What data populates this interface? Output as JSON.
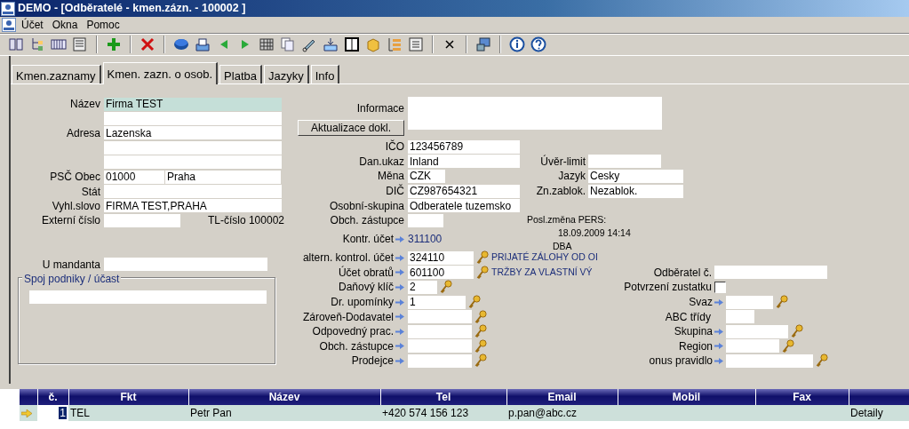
{
  "window": {
    "title": "DEMO - [Odběratelé - kmen.zázn. - 100002 ]"
  },
  "menu": {
    "items": [
      {
        "label": "Účet"
      },
      {
        "label": "Okna"
      },
      {
        "label": "Pomoc"
      }
    ]
  },
  "tabs": [
    {
      "label": "Kmen.zaznamy",
      "selected": false
    },
    {
      "label": "Kmen. zazn. o osob.",
      "selected": true
    },
    {
      "label": "Platba",
      "selected": false
    },
    {
      "label": "Jazyky",
      "selected": false
    },
    {
      "label": "Info",
      "selected": false
    }
  ],
  "left_fields": [
    {
      "kind": "field",
      "label": "Název",
      "value": "Firma TEST",
      "focused": true
    },
    {
      "kind": "field",
      "focused": false
    },
    {
      "kind": "field",
      "label": "Adresa",
      "value": "Lazenska",
      "focused": false
    },
    {
      "kind": "field",
      "focused": false
    },
    {
      "kind": "field",
      "focused": false
    },
    {
      "kind": "pair",
      "label": "PSČ Obec",
      "value": "01000",
      "value2": "Praha",
      "focused": false
    },
    {
      "kind": "field",
      "label": "Stát",
      "focused": false
    },
    {
      "kind": "field",
      "label": "Vyhl.slovo",
      "value": "FIRMA TEST,PRAHA",
      "focused": false
    },
    {
      "kind": "short",
      "label": "Externí číslo",
      "note": "TL-číslo 100002",
      "focused": false
    },
    {
      "kind": "field",
      "label": "U mandanta",
      "focused": false
    }
  ],
  "group": {
    "title": "Spoj podniky / účast"
  },
  "info": {
    "label": "Informace",
    "button": "Aktualizace dokl."
  },
  "middle_fields": [
    {
      "kind": "field",
      "label": "IČO",
      "value": "123456789"
    },
    {
      "kind": "field",
      "label": "Dan.ukaz",
      "value": "Inland"
    },
    {
      "kind": "field",
      "label": "Měna",
      "value": "CZK"
    },
    {
      "kind": "field",
      "label": "DIČ",
      "value": "CZ987654321"
    },
    {
      "kind": "field",
      "label": "Osobní-skupina",
      "value": "Odberatele tuzemsko"
    },
    {
      "kind": "field",
      "label": "Obch. zástupce"
    },
    {
      "kind": "link",
      "label": "Kontr. účet",
      "value": "311100"
    },
    {
      "kind": "lookup",
      "label": "altern. kontrol. účet",
      "value": "324110",
      "description": "PRIJATÉ ZÁLOHY OD OI"
    },
    {
      "kind": "lookup",
      "label": "Účet obratů",
      "value": "601100",
      "description": "TRŽBY ZA VLASTNÍ VÝ"
    },
    {
      "kind": "lookup",
      "label": "Daňový klíč",
      "value": "2"
    },
    {
      "kind": "lookup",
      "label": "Dr. upomínky",
      "value": "1"
    },
    {
      "kind": "lookup",
      "label": "Zároveň-Dodavatel"
    },
    {
      "kind": "lookup",
      "label": "Odpovedný prac."
    },
    {
      "kind": "lookup",
      "label": "Obch. zástupce"
    },
    {
      "kind": "lookup",
      "label": "Prodejce"
    }
  ],
  "right_fields": [
    {
      "kind": "field",
      "label": "Úvěr-limit"
    },
    {
      "kind": "field",
      "label": "Jazyk",
      "value": "Cesky"
    },
    {
      "kind": "field",
      "label": "Zn.zablok.",
      "value": "Nezablok."
    },
    {
      "kind": "note",
      "lines": [
        "Posl.změna PERS:",
        "18.09.2009 14:14",
        "DBA"
      ]
    },
    {
      "kind": "field",
      "label": "Odběratel č."
    },
    {
      "kind": "checkbox",
      "label": "Potvrzení zustatku",
      "checked": false
    },
    {
      "kind": "lookup",
      "label": "Svaz"
    },
    {
      "kind": "plain",
      "label": "ABC třídy"
    },
    {
      "kind": "lookup",
      "label": "Skupina"
    },
    {
      "kind": "lookup",
      "label": "Region"
    },
    {
      "kind": "lookup",
      "label": "onus pravidlo"
    }
  ],
  "table": {
    "columns": [
      "č.",
      "Fkt",
      "Název",
      "Tel",
      "Email",
      "Mobil",
      "Fax",
      null
    ],
    "rows": [
      {
        "current": true,
        "cells": [
          "1",
          "TEL",
          "Petr Pan",
          "+420 574 156 123",
          "p.pan@abc.cz",
          null,
          null,
          "Detaily"
        ]
      }
    ]
  }
}
